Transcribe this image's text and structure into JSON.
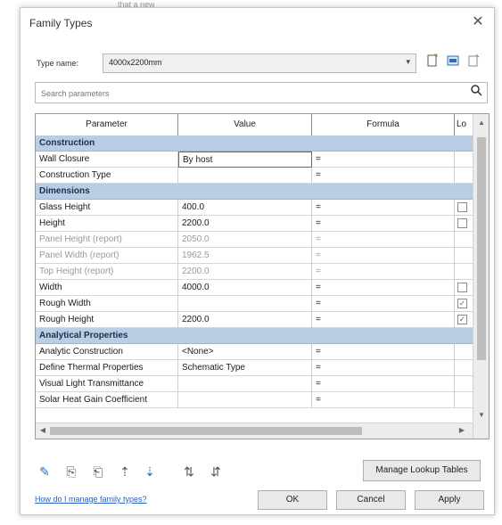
{
  "background": {
    "partial_text": "that a new"
  },
  "dialog": {
    "title": "Family Types",
    "close_glyph": "✕",
    "type_name_label": "Type name:",
    "type_name_value": "4000x2200mm",
    "search_placeholder": "Search parameters",
    "columns": [
      "Parameter",
      "Value",
      "Formula",
      "Lo"
    ],
    "rows": [
      {
        "kind": "group",
        "label": "Construction"
      },
      {
        "kind": "param",
        "param": "Wall Closure",
        "value": "By host",
        "formula": "=",
        "lock": "none",
        "dim": false,
        "editing": true
      },
      {
        "kind": "param",
        "param": "Construction Type",
        "value": "",
        "formula": "=",
        "lock": "none",
        "dim": false
      },
      {
        "kind": "group",
        "label": "Dimensions"
      },
      {
        "kind": "param",
        "param": "Glass Height",
        "value": "400.0",
        "formula": "=",
        "lock": "unchecked",
        "dim": false
      },
      {
        "kind": "param",
        "param": "Height",
        "value": "2200.0",
        "formula": "=",
        "lock": "unchecked",
        "dim": false
      },
      {
        "kind": "param",
        "param": "Panel Height (report)",
        "value": "2050.0",
        "formula": "=",
        "lock": "none",
        "dim": true
      },
      {
        "kind": "param",
        "param": "Panel Width (report)",
        "value": "1962.5",
        "formula": "=",
        "lock": "none",
        "dim": true
      },
      {
        "kind": "param",
        "param": "Top Height (report)",
        "value": "2200.0",
        "formula": "=",
        "lock": "none",
        "dim": true
      },
      {
        "kind": "param",
        "param": "Width",
        "value": "4000.0",
        "formula": "=",
        "lock": "unchecked",
        "dim": false
      },
      {
        "kind": "param",
        "param": "Rough Width",
        "value": "",
        "formula": "=",
        "lock": "checked-gray",
        "dim": false
      },
      {
        "kind": "param",
        "param": "Rough Height",
        "value": "2200.0",
        "formula": "=",
        "lock": "checked-gray",
        "dim": false
      },
      {
        "kind": "group",
        "label": "Analytical Properties"
      },
      {
        "kind": "param",
        "param": "Analytic Construction",
        "value": "<None>",
        "formula": "=",
        "lock": "none",
        "dim": false
      },
      {
        "kind": "param",
        "param": "Define Thermal Properties",
        "value": "Schematic Type",
        "formula": "=",
        "lock": "none",
        "dim": false
      },
      {
        "kind": "param",
        "param": "Visual Light Transmittance",
        "value": "",
        "formula": "=",
        "lock": "none",
        "dim": false
      },
      {
        "kind": "param",
        "param": "Solar Heat Gain Coefficient",
        "value": "",
        "formula": "=",
        "lock": "none",
        "dim": false
      }
    ],
    "toolbar_icons": [
      "pencil-icon",
      "new-parameter-icon",
      "delete-parameter-icon",
      "move-up-icon",
      "move-down-icon",
      "sort-ascending-icon",
      "sort-descending-icon"
    ],
    "manage_lookup_tables_label": "Manage Lookup Tables",
    "help_link": "How do I manage family types?",
    "ok_label": "OK",
    "cancel_label": "Cancel",
    "apply_label": "Apply",
    "colors": {
      "group_band": "#b9cde5",
      "link": "#2860c0",
      "accent_icon": "#2d6db4"
    }
  }
}
